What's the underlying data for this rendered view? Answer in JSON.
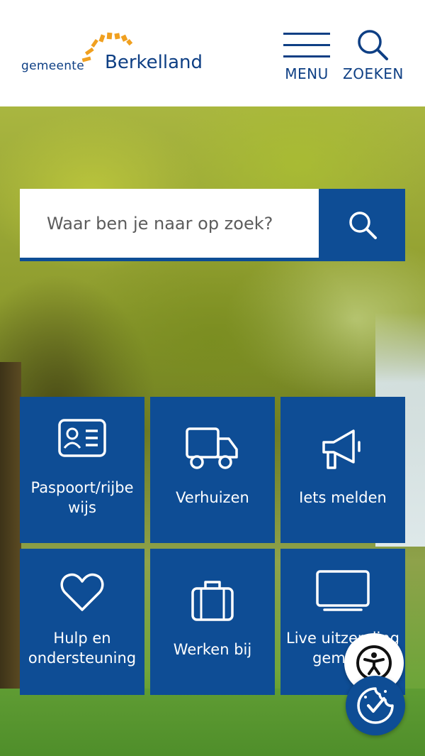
{
  "header": {
    "logo": {
      "word1": "gemeente",
      "word2": "Berkelland"
    },
    "menu_label": "MENU",
    "search_label": "ZOEKEN"
  },
  "search": {
    "placeholder": "Waar ben je naar op zoek?"
  },
  "tiles": [
    {
      "label": "Paspoort/rijbe wijs",
      "icon": "id-card-icon"
    },
    {
      "label": "Verhuizen",
      "icon": "truck-icon"
    },
    {
      "label": "Iets melden",
      "icon": "megaphone-icon"
    },
    {
      "label": "Hulp en ondersteuning",
      "icon": "heart-icon"
    },
    {
      "label": "Werken bij",
      "icon": "briefcase-icon"
    },
    {
      "label": "Live uitzending gemeen",
      "icon": "monitor-icon"
    }
  ],
  "floating": {
    "accessibility_icon": "accessibility-icon",
    "cookie_icon": "cookie-check-icon"
  },
  "colors": {
    "brand_blue": "#0e4d95",
    "logo_blue": "#0e3f84",
    "logo_sun": "#f0a020"
  }
}
